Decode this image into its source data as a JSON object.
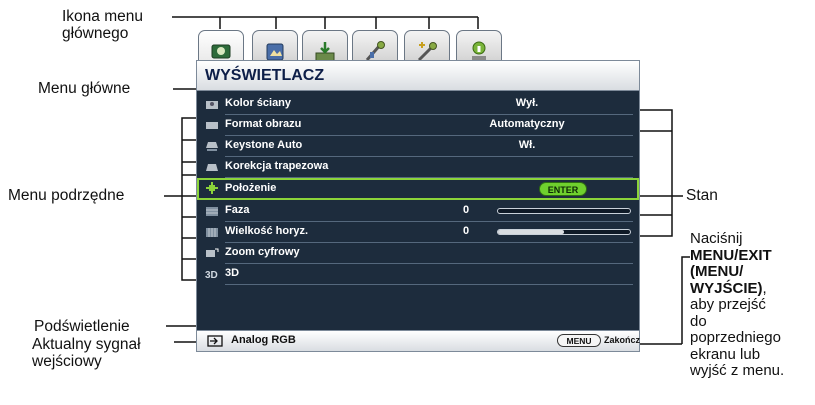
{
  "callouts": {
    "main_menu_icon": [
      "Ikona menu",
      "głównego"
    ],
    "main_menu": "Menu główne",
    "submenu": "Menu podrzędne",
    "status": "Stan",
    "highlight": "Podświetlenie",
    "current_input": [
      "Aktualny sygnał",
      "wejściowy"
    ],
    "press_prefix": "Naciśnij",
    "press_bold": [
      "MENU/EXIT",
      "(MENU/",
      "WYJŚCIE)"
    ],
    "press_comma": ",",
    "press_rest": [
      "aby przejść",
      "do",
      "poprzedniego",
      "ekranu lub",
      "wyjść z menu."
    ]
  },
  "osd": {
    "title": "WYŚWIETLACZ",
    "tabs": [
      "display-tab-icon",
      "picture-tab-icon",
      "source-tab-icon",
      "system-tab-icon",
      "advanced-tab-icon",
      "info-tab-icon"
    ],
    "rows": [
      {
        "name": "Kolor ściany",
        "value": "Wył."
      },
      {
        "name": "Format obrazu",
        "value": "Automatyczny"
      },
      {
        "name": "Keystone Auto",
        "value": "Wł."
      },
      {
        "name": "Korekcja trapezowa",
        "value": ""
      },
      {
        "name": "Położenie",
        "value": "ENTER"
      },
      {
        "name": "Faza",
        "value": "0",
        "slider": 0.0
      },
      {
        "name": "Wielkość horyz.",
        "value": "0",
        "slider": 0.5
      },
      {
        "name": "Zoom cyfrowy",
        "value": ""
      },
      {
        "name": "3D",
        "value": ""
      }
    ],
    "source": "Analog RGB",
    "menu_button": "MENU",
    "exit_label": "Zakończ",
    "colors": {
      "panel": "#1d2c3d",
      "highlight": "#8bd43a",
      "enter": "#6fd02e",
      "title_text": "#0d1e48"
    }
  }
}
